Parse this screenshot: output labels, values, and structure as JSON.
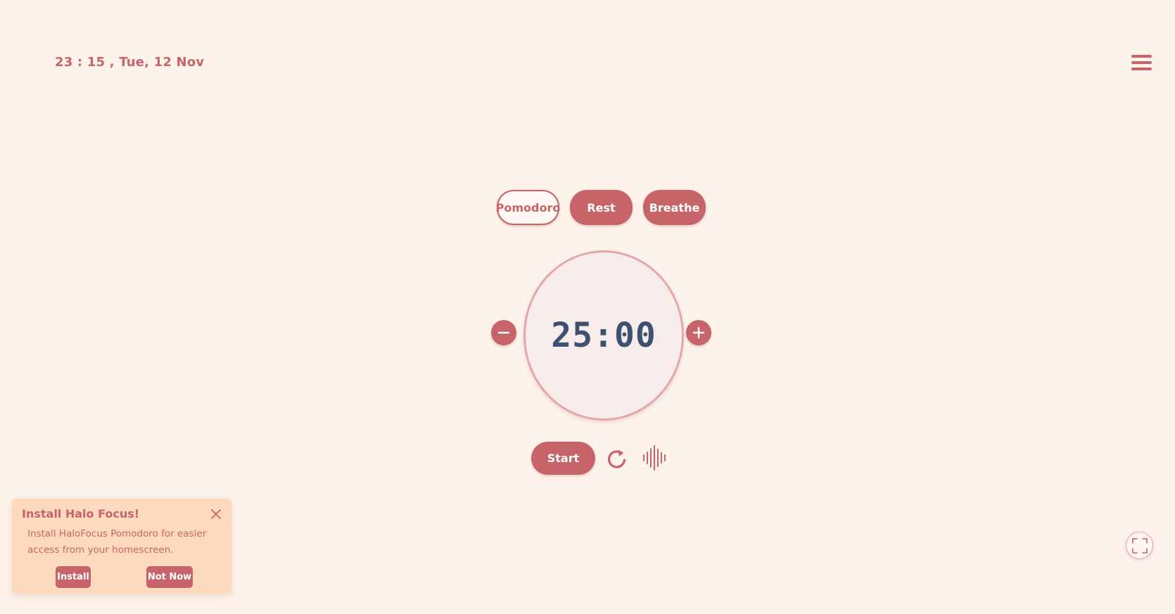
{
  "header": {
    "datetime": "23 : 15 ,  Tue, 12 Nov"
  },
  "menu": {
    "icon": "hamburger-menu-icon"
  },
  "modes": [
    {
      "label": "Pomodoro",
      "active": true
    },
    {
      "label": "Rest",
      "active": false
    },
    {
      "label": "Breathe",
      "active": false
    }
  ],
  "timer": {
    "display": "25:00",
    "decrease_icon": "minus-icon",
    "increase_icon": "plus-icon"
  },
  "controls": {
    "start_label": "Start",
    "reset_icon": "refresh-icon",
    "sound_icon": "sound-wave-icon"
  },
  "install_prompt": {
    "title": "Install Halo Focus!",
    "message": "Install HaloFocus Pomodoro for easier access from your homescreen.",
    "install_label": "Install",
    "dismiss_label": "Not Now",
    "close_icon": "close-icon"
  },
  "fullscreen": {
    "icon": "fullscreen-icon"
  },
  "colors": {
    "background": "#fdf3ea",
    "accent": "#c7646a",
    "timer_text": "#3d5170",
    "timer_face": "#f8ecea",
    "card_bg": "#fdd9bd"
  }
}
